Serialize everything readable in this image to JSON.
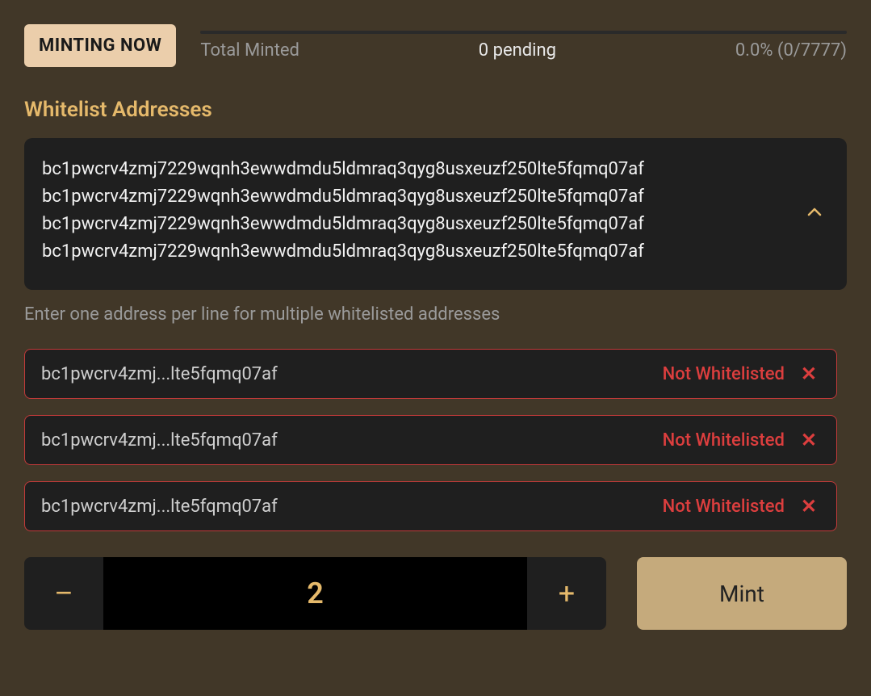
{
  "header": {
    "badge": "MINTING NOW",
    "total_label": "Total Minted",
    "pending_label": "0 pending",
    "progress_label": "0.0% (0/7777)"
  },
  "whitelist": {
    "title": "Whitelist Addresses",
    "textarea_value": "bc1pwcrv4zmj7229wqnh3ewwdmdu5ldmraq3qyg8usxeuzf250lte5fqmq07af\nbc1pwcrv4zmj7229wqnh3ewwdmdu5ldmraq3qyg8usxeuzf250lte5fqmq07af\nbc1pwcrv4zmj7229wqnh3ewwdmdu5ldmraq3qyg8usxeuzf250lte5fqmq07af\nbc1pwcrv4zmj7229wqnh3ewwdmdu5ldmraq3qyg8usxeuzf250lte5fqmq07af",
    "hint": "Enter one address per line for multiple whitelisted addresses",
    "entries": [
      {
        "short": "bc1pwcrv4zmj...lte5fqmq07af",
        "status": "Not Whitelisted"
      },
      {
        "short": "bc1pwcrv4zmj...lte5fqmq07af",
        "status": "Not Whitelisted"
      },
      {
        "short": "bc1pwcrv4zmj...lte5fqmq07af",
        "status": "Not Whitelisted"
      }
    ]
  },
  "stepper": {
    "minus": "–",
    "plus": "+",
    "value": "2"
  },
  "mint_label": "Mint"
}
